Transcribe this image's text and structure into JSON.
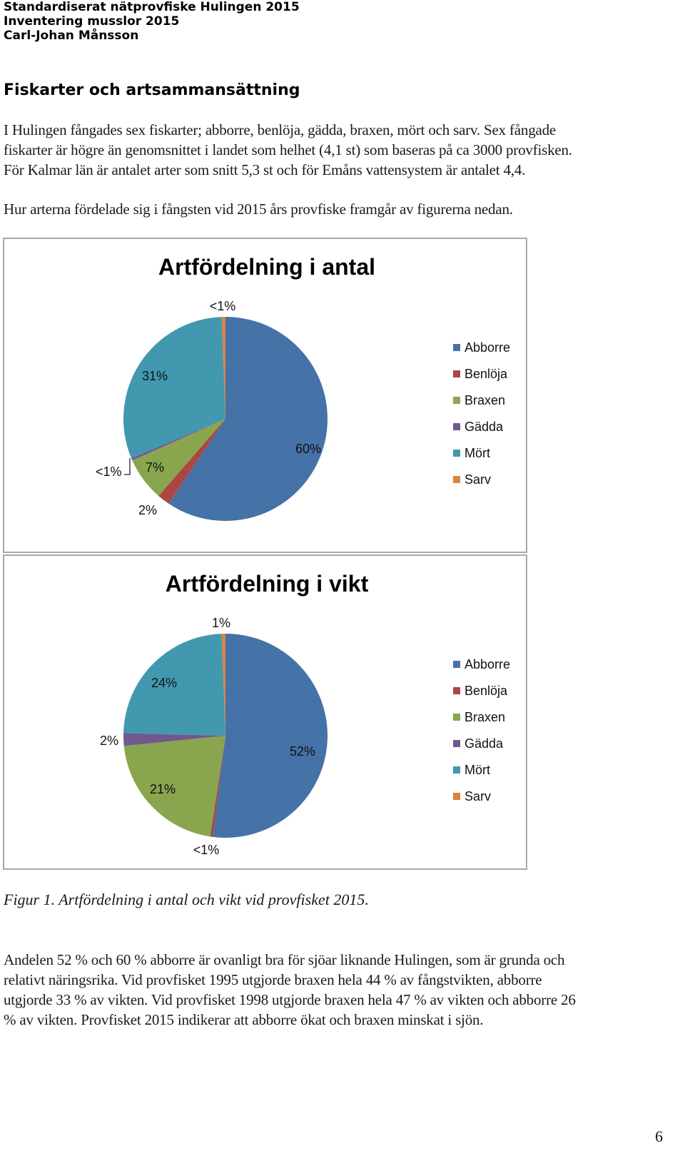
{
  "header": {
    "line1": "Standardiserat nätprovfiske Hulingen 2015",
    "line2": "Inventering musslor 2015",
    "line3": "Carl-Johan Månsson"
  },
  "section_title": "Fiskarter och artsammansättning",
  "intro_paragraph": [
    "I Hulingen fångades sex fiskarter; abborre, benlöja, gädda, braxen, mört och sarv. Sex fångade",
    "fiskarter är högre än genomsnittet i landet som helhet (4,1 st) som baseras på ca 3000 provfisken.",
    "För Kalmar län är antalet arter som snitt 5,3 st och för Emåns vattensystem är antalet 4,4."
  ],
  "lead_paragraph": "Hur arterna fördelade sig i fångsten vid 2015 års provfiske framgår av figurerna nedan.",
  "chart_data": [
    {
      "type": "pie",
      "title": "Artfördelning i antal",
      "categories": [
        "Abborre",
        "Benlöja",
        "Braxen",
        "Gädda",
        "Mört",
        "Sarv"
      ],
      "values": [
        60,
        2,
        7,
        0.4,
        31,
        0.6
      ],
      "data_labels": [
        "60%",
        "2%",
        "7%",
        "<1%",
        "31%",
        "<1%"
      ],
      "colors": [
        "#4572a7",
        "#aa4643",
        "#89a54e",
        "#71588f",
        "#4198af",
        "#db843d"
      ],
      "legend": "right"
    },
    {
      "type": "pie",
      "title": "Artfördelning i vikt",
      "categories": [
        "Abborre",
        "Benlöja",
        "Braxen",
        "Gädda",
        "Mört",
        "Sarv"
      ],
      "values": [
        52,
        0.4,
        21,
        2,
        24,
        0.6
      ],
      "data_labels": [
        "52%",
        "<1%",
        "21%",
        "2%",
        "24%",
        "1%"
      ],
      "colors": [
        "#4572a7",
        "#aa4643",
        "#89a54e",
        "#71588f",
        "#4198af",
        "#db843d"
      ],
      "legend": "right"
    }
  ],
  "caption": "Figur 1. Artfördelning i antal och vikt vid provfisket 2015.",
  "closing_paragraph": [
    "Andelen 52 % och 60 % abborre är ovanligt bra för sjöar liknande Hulingen, som är grunda och",
    "relativt näringsrika. Vid provfisket 1995 utgjorde braxen hela 44 % av fångstvikten, abborre",
    "utgjorde 33 % av vikten. Vid provfisket 1998 utgjorde braxen hela 47 % av vikten och abborre 26",
    "% av vikten. Provfisket 2015 indikerar att abborre ökat och braxen minskat i sjön."
  ],
  "page_number": "6"
}
